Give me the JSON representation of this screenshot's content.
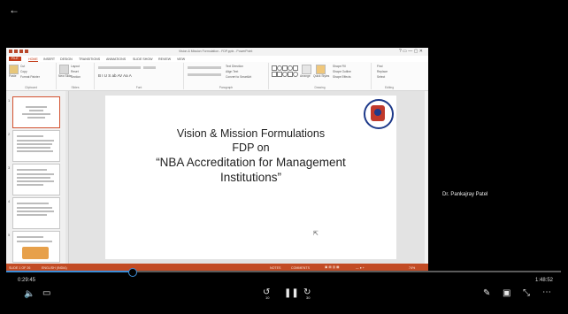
{
  "player": {
    "back_icon": "←",
    "elapsed": "0:29:45",
    "duration": "1:48:52",
    "progress_fraction": 0.227,
    "skip_back_label": "10",
    "skip_forward_label": "30"
  },
  "ppt": {
    "title": "Vision & Mission Formulation - FDP.pptx - PowerPoint",
    "account": "Microsoft account",
    "tabs": [
      "FILE",
      "HOME",
      "INSERT",
      "DESIGN",
      "TRANSITIONS",
      "ANIMATIONS",
      "SLIDE SHOW",
      "REVIEW",
      "VIEW"
    ],
    "ribbon": {
      "clipboard": "Clipboard",
      "slides": "Slides",
      "font": "Font",
      "paragraph": "Paragraph",
      "drawing": "Drawing",
      "editing": "Editing",
      "paste": "Paste",
      "cut": "Cut",
      "copy": "Copy",
      "format_painter": "Format Painter",
      "new_slide": "New Slide",
      "layout": "Layout",
      "reset": "Reset",
      "section": "Section",
      "text_direction": "Text Direction",
      "align_text": "Align Text",
      "convert_smartart": "Convert to SmartArt",
      "arrange": "Arrange",
      "quick_styles": "Quick Styles",
      "shape_fill": "Shape Fill",
      "shape_outline": "Shape Outline",
      "shape_effects": "Shape Effects",
      "find": "Find",
      "replace": "Replace",
      "select": "Select"
    },
    "slide_numbers": [
      "1",
      "2",
      "3",
      "4",
      "5"
    ],
    "slide": {
      "line1": "Vision & Mission Formulations",
      "line2": "FDP on",
      "line3": "“NBA Accreditation for Management",
      "line4": "Institutions”"
    },
    "status": {
      "slide_count": "SLIDE 1 OF 26",
      "language": "ENGLISH (INDIA)",
      "notes": "NOTES",
      "comments": "COMMENTS",
      "zoom": "74%"
    }
  },
  "presenter": {
    "name": "Dr. Pankajray Patel"
  }
}
